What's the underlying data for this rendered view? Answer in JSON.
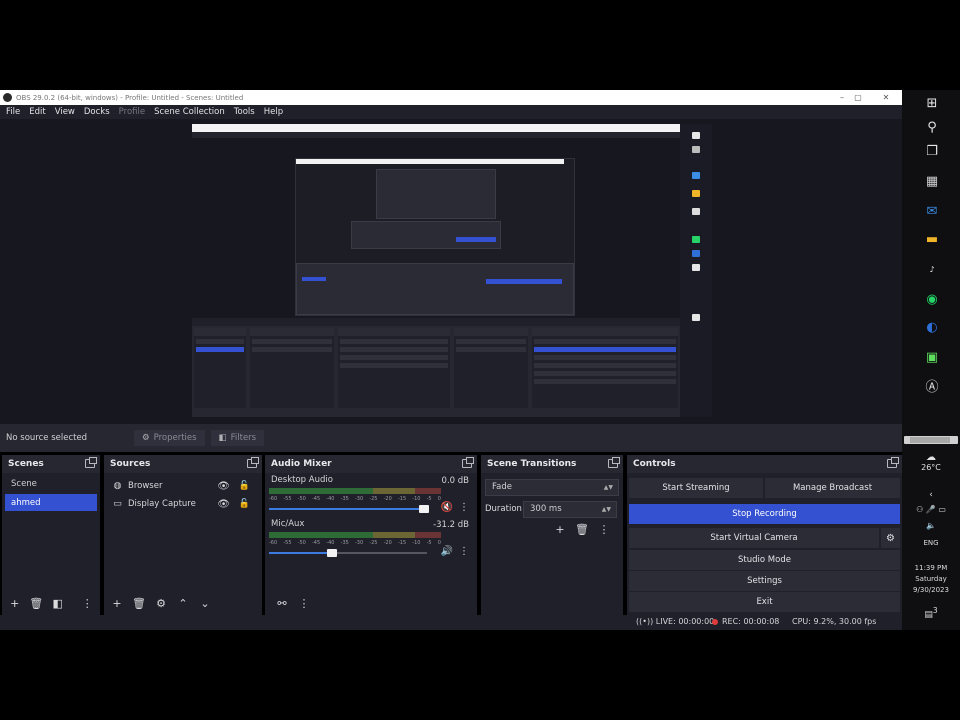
{
  "window": {
    "title": "OBS 29.0.2 (64-bit, windows) - Profile: Untitled - Scenes: Untitled",
    "controls": [
      "–",
      "▢",
      "✕"
    ]
  },
  "menu": [
    "File",
    "Edit",
    "View",
    "Docks",
    "Profile",
    "Scene Collection",
    "Tools",
    "Help"
  ],
  "source_toolbar": {
    "status": "No source selected",
    "properties_label": "Properties",
    "filters_label": "Filters"
  },
  "scenes": {
    "title": "Scenes",
    "items": [
      "Scene",
      "ahmed"
    ],
    "selected_index": 1
  },
  "sources": {
    "title": "Sources",
    "items": [
      {
        "name": "Browser",
        "icon": "globe-icon"
      },
      {
        "name": "Display Capture",
        "icon": "monitor-icon"
      }
    ]
  },
  "audio_mixer": {
    "title": "Audio Mixer",
    "channels": [
      {
        "name": "Desktop Audio",
        "db": "0.0 dB",
        "muted": true,
        "volume": 0.96
      },
      {
        "name": "Mic/Aux",
        "db": "-31.2 dB",
        "muted": false,
        "volume": 0.38
      }
    ],
    "tick_labels": [
      "-60",
      "-55",
      "-50",
      "-45",
      "-40",
      "-35",
      "-30",
      "-25",
      "-20",
      "-15",
      "-10",
      "-5",
      "0"
    ]
  },
  "scene_transitions": {
    "title": "Scene Transitions",
    "transition": "Fade",
    "duration_label": "Duration",
    "duration_value": "300 ms"
  },
  "controls": {
    "title": "Controls",
    "start_streaming": "Start Streaming",
    "manage_broadcast": "Manage Broadcast",
    "stop_recording": "Stop Recording",
    "start_virtual_camera": "Start Virtual Camera",
    "studio_mode": "Studio Mode",
    "settings": "Settings",
    "exit": "Exit"
  },
  "status": {
    "live": "LIVE: 00:00:00",
    "rec": "REC: 00:00:08",
    "cpu": "CPU: 9.2%, 30.00 fps"
  },
  "taskbar": {
    "temperature": "26°C",
    "language": "ENG",
    "time": "11:39 PM",
    "day": "Saturday",
    "date": "9/30/2023",
    "notification_count": "3"
  },
  "colors": {
    "accent": "#3451d1",
    "panel": "#1f2029",
    "header": "#262730",
    "rec": "#e03a3a"
  }
}
